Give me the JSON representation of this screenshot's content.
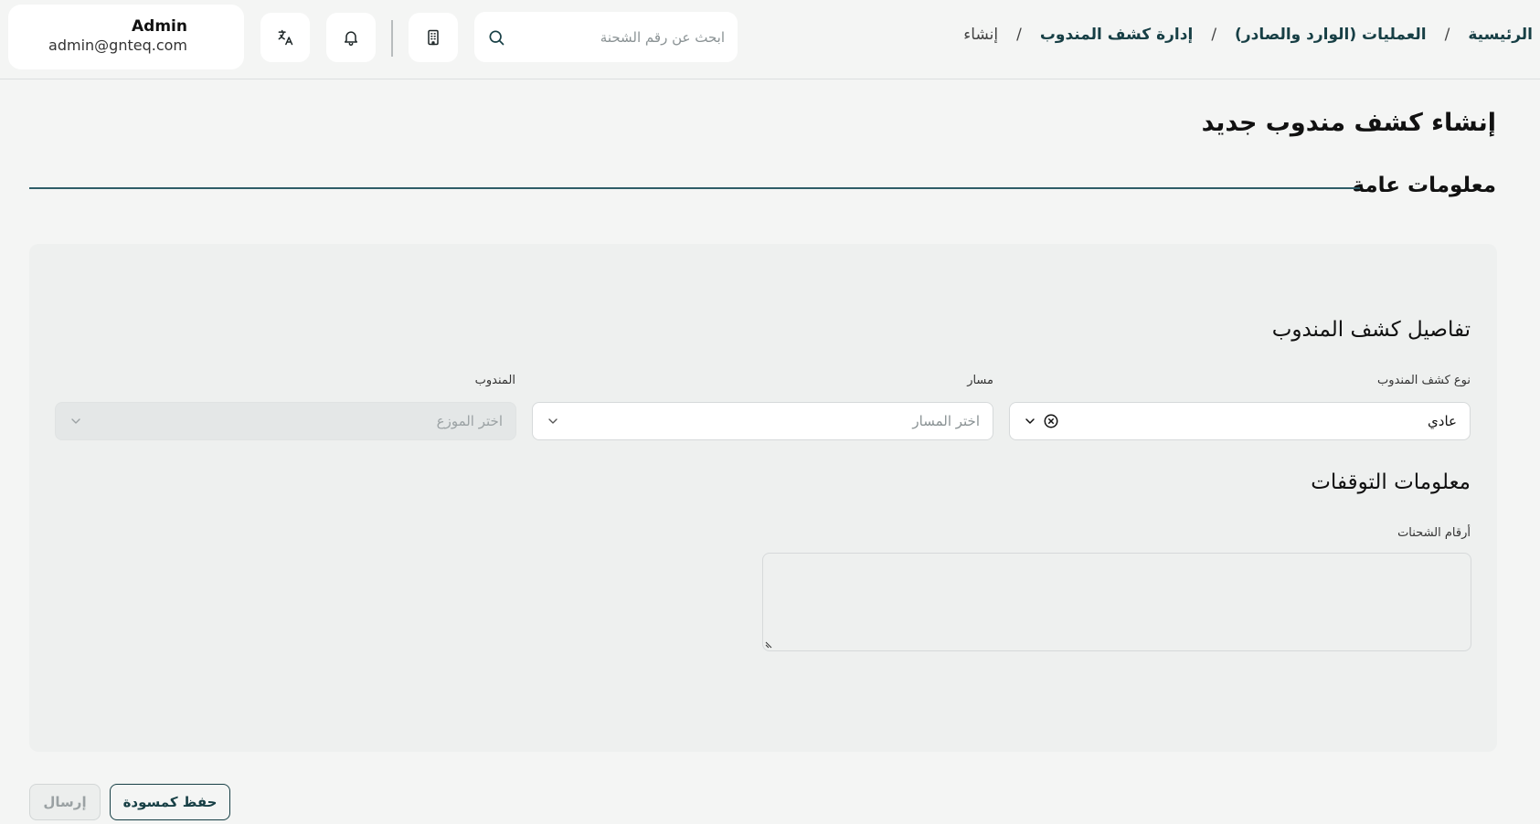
{
  "header": {
    "user": {
      "name": "Admin",
      "email": "admin@gnteq.com"
    },
    "search": {
      "placeholder": "ابحث عن رقم الشحنة",
      "value": ""
    },
    "icons": [
      "translate-icon",
      "bell-icon",
      "building-icon",
      "search-icon"
    ]
  },
  "breadcrumb": {
    "items": [
      "الرئيسية",
      "العمليات (الوارد والصادر)",
      "إدارة كشف المندوب",
      "إنشاء"
    ],
    "separator": "/"
  },
  "page": {
    "title": "إنشاء كشف مندوب جديد",
    "section_title": "معلومات عامة"
  },
  "form": {
    "details_title": "تفاصيل كشف المندوب",
    "type_field": {
      "label": "نوع كشف المندوب",
      "value": "عادي"
    },
    "route_field": {
      "label": "مسار",
      "placeholder": "اختر المسار"
    },
    "agent_field": {
      "label": "المندوب",
      "placeholder": "اختر الموزع"
    },
    "stops_title": "معلومات التوقفات",
    "shipments_field": {
      "label": "أرقام الشحنات",
      "value": ""
    }
  },
  "actions": {
    "save_draft": "حفظ كمسودة",
    "submit": "إرسال"
  },
  "colors": {
    "accent": "#173f45",
    "section_line": "#2f5d68",
    "background": "#f4f5f4",
    "panel": "#eef0ef"
  }
}
